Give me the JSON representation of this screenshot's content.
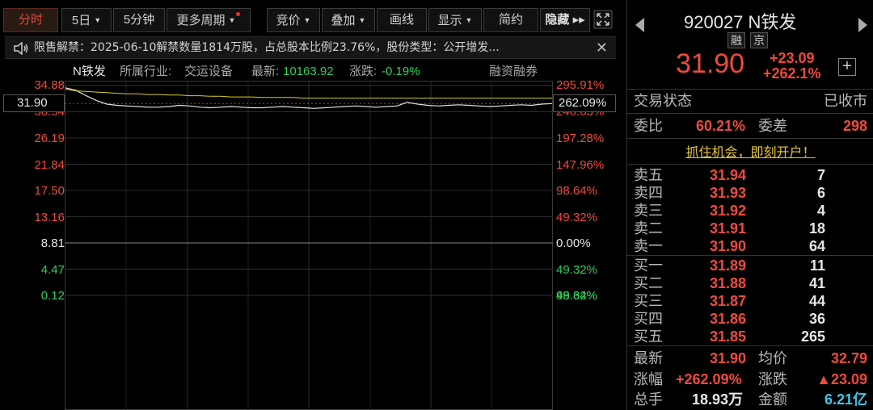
{
  "toolbar": {
    "tabs": [
      {
        "label": "分时",
        "active": true
      },
      {
        "label": "5日",
        "dropdown": true
      },
      {
        "label": "5分钟"
      },
      {
        "label": "更多周期",
        "dropdown": true,
        "dot": true
      },
      {
        "label": "竞价",
        "dropdown": true
      },
      {
        "label": "叠加",
        "dropdown": true
      },
      {
        "label": "画线"
      },
      {
        "label": "显示",
        "dropdown": true
      },
      {
        "label": "简约"
      },
      {
        "label": "隐藏"
      }
    ],
    "hide_arrows": "▸▸"
  },
  "notice": {
    "text": "限售解禁：2025-06-10解禁数量1814万股，占总股本比例23.76%，股份类型：公开增发...",
    "close": "✕"
  },
  "info": {
    "name": "N铁发",
    "industry_label": "所属行业:",
    "industry": "交运设备",
    "latest_label": "最新:",
    "latest": "10163.92",
    "change_label": "涨跌:",
    "change": "-0.19%",
    "margin": "融资融券"
  },
  "chart_data": {
    "type": "line",
    "title": "",
    "price_axis": [
      "34.88",
      "30.54",
      "26.19",
      "21.84",
      "17.50",
      "13.16",
      "8.81",
      "4.47",
      "0.12"
    ],
    "pct_axis": [
      "295.91%",
      "246.63%",
      "197.28%",
      "147.96%",
      "98.64%",
      "49.32%",
      "0.00%",
      "49.32%",
      "98.64%"
    ],
    "current_price_label": "31.90",
    "current_pct_label": "262.09%",
    "ylim": [
      0.12,
      34.88
    ],
    "prev_close": 8.81,
    "series": [
      {
        "color": "#e0e0e0",
        "values": [
          34.5,
          34.1,
          33.2,
          32.4,
          31.8,
          31.6,
          31.5,
          31.4,
          31.3,
          31.3,
          31.4,
          31.6,
          31.5,
          31.3,
          31.2,
          31.3,
          31.4,
          31.3,
          31.2,
          31.2,
          31.3,
          31.4,
          31.3,
          31.2,
          31.1,
          31.2,
          31.3,
          31.4,
          31.5,
          31.4,
          31.3,
          31.4,
          31.5,
          32.1,
          31.8,
          31.6,
          31.5,
          31.6,
          31.7,
          31.6,
          31.5,
          31.4,
          31.5,
          31.6,
          31.7,
          31.6,
          31.8,
          31.9
        ]
      },
      {
        "color": "#d8d020",
        "values": [
          34.3,
          34.0,
          33.9,
          33.8,
          33.7,
          33.6,
          33.5,
          33.5,
          33.4,
          33.4,
          33.3,
          33.3,
          33.2,
          33.2,
          33.1,
          33.1,
          33.0,
          33.0,
          33.0,
          32.9,
          32.9,
          32.9,
          32.9,
          32.8,
          32.8,
          32.8,
          32.8,
          32.8,
          32.8,
          32.8,
          32.8,
          32.8,
          32.8,
          32.8,
          32.8,
          32.8,
          32.8,
          32.8,
          32.8,
          32.8,
          32.8,
          32.8,
          32.8,
          32.8,
          32.8,
          32.8,
          32.8,
          32.79
        ]
      }
    ],
    "grid": true
  },
  "quote": {
    "code": "920027",
    "name": "N铁发",
    "tags": [
      "融",
      "京"
    ],
    "price": "31.90",
    "change": "+23.09",
    "change_pct": "+262.1%",
    "plus": "+"
  },
  "status": {
    "label": "交易状态",
    "value": "已收市"
  },
  "ratio": {
    "wb_label": "委比",
    "wb": "60.21%",
    "wc_label": "委差",
    "wc": "298"
  },
  "promo": "抓住机会，即刻开户！",
  "asks": [
    {
      "label": "卖五",
      "price": "31.94",
      "vol": "7"
    },
    {
      "label": "卖四",
      "price": "31.93",
      "vol": "6"
    },
    {
      "label": "卖三",
      "price": "31.92",
      "vol": "4"
    },
    {
      "label": "卖二",
      "price": "31.91",
      "vol": "18"
    },
    {
      "label": "卖一",
      "price": "31.90",
      "vol": "64"
    }
  ],
  "bids": [
    {
      "label": "买一",
      "price": "31.89",
      "vol": "11"
    },
    {
      "label": "买二",
      "price": "31.88",
      "vol": "41"
    },
    {
      "label": "买三",
      "price": "31.87",
      "vol": "44"
    },
    {
      "label": "买四",
      "price": "31.86",
      "vol": "36"
    },
    {
      "label": "买五",
      "price": "31.85",
      "vol": "265"
    }
  ],
  "summary": {
    "latest_label": "最新",
    "latest": "31.90",
    "avg_label": "均价",
    "avg": "32.79",
    "chgpct_label": "涨幅",
    "chgpct": "+262.09%",
    "chg_label": "涨跌",
    "chg": "▲23.09",
    "vol_label": "总手",
    "vol": "18.93万",
    "amt_label": "金额",
    "amt": "6.21亿"
  }
}
